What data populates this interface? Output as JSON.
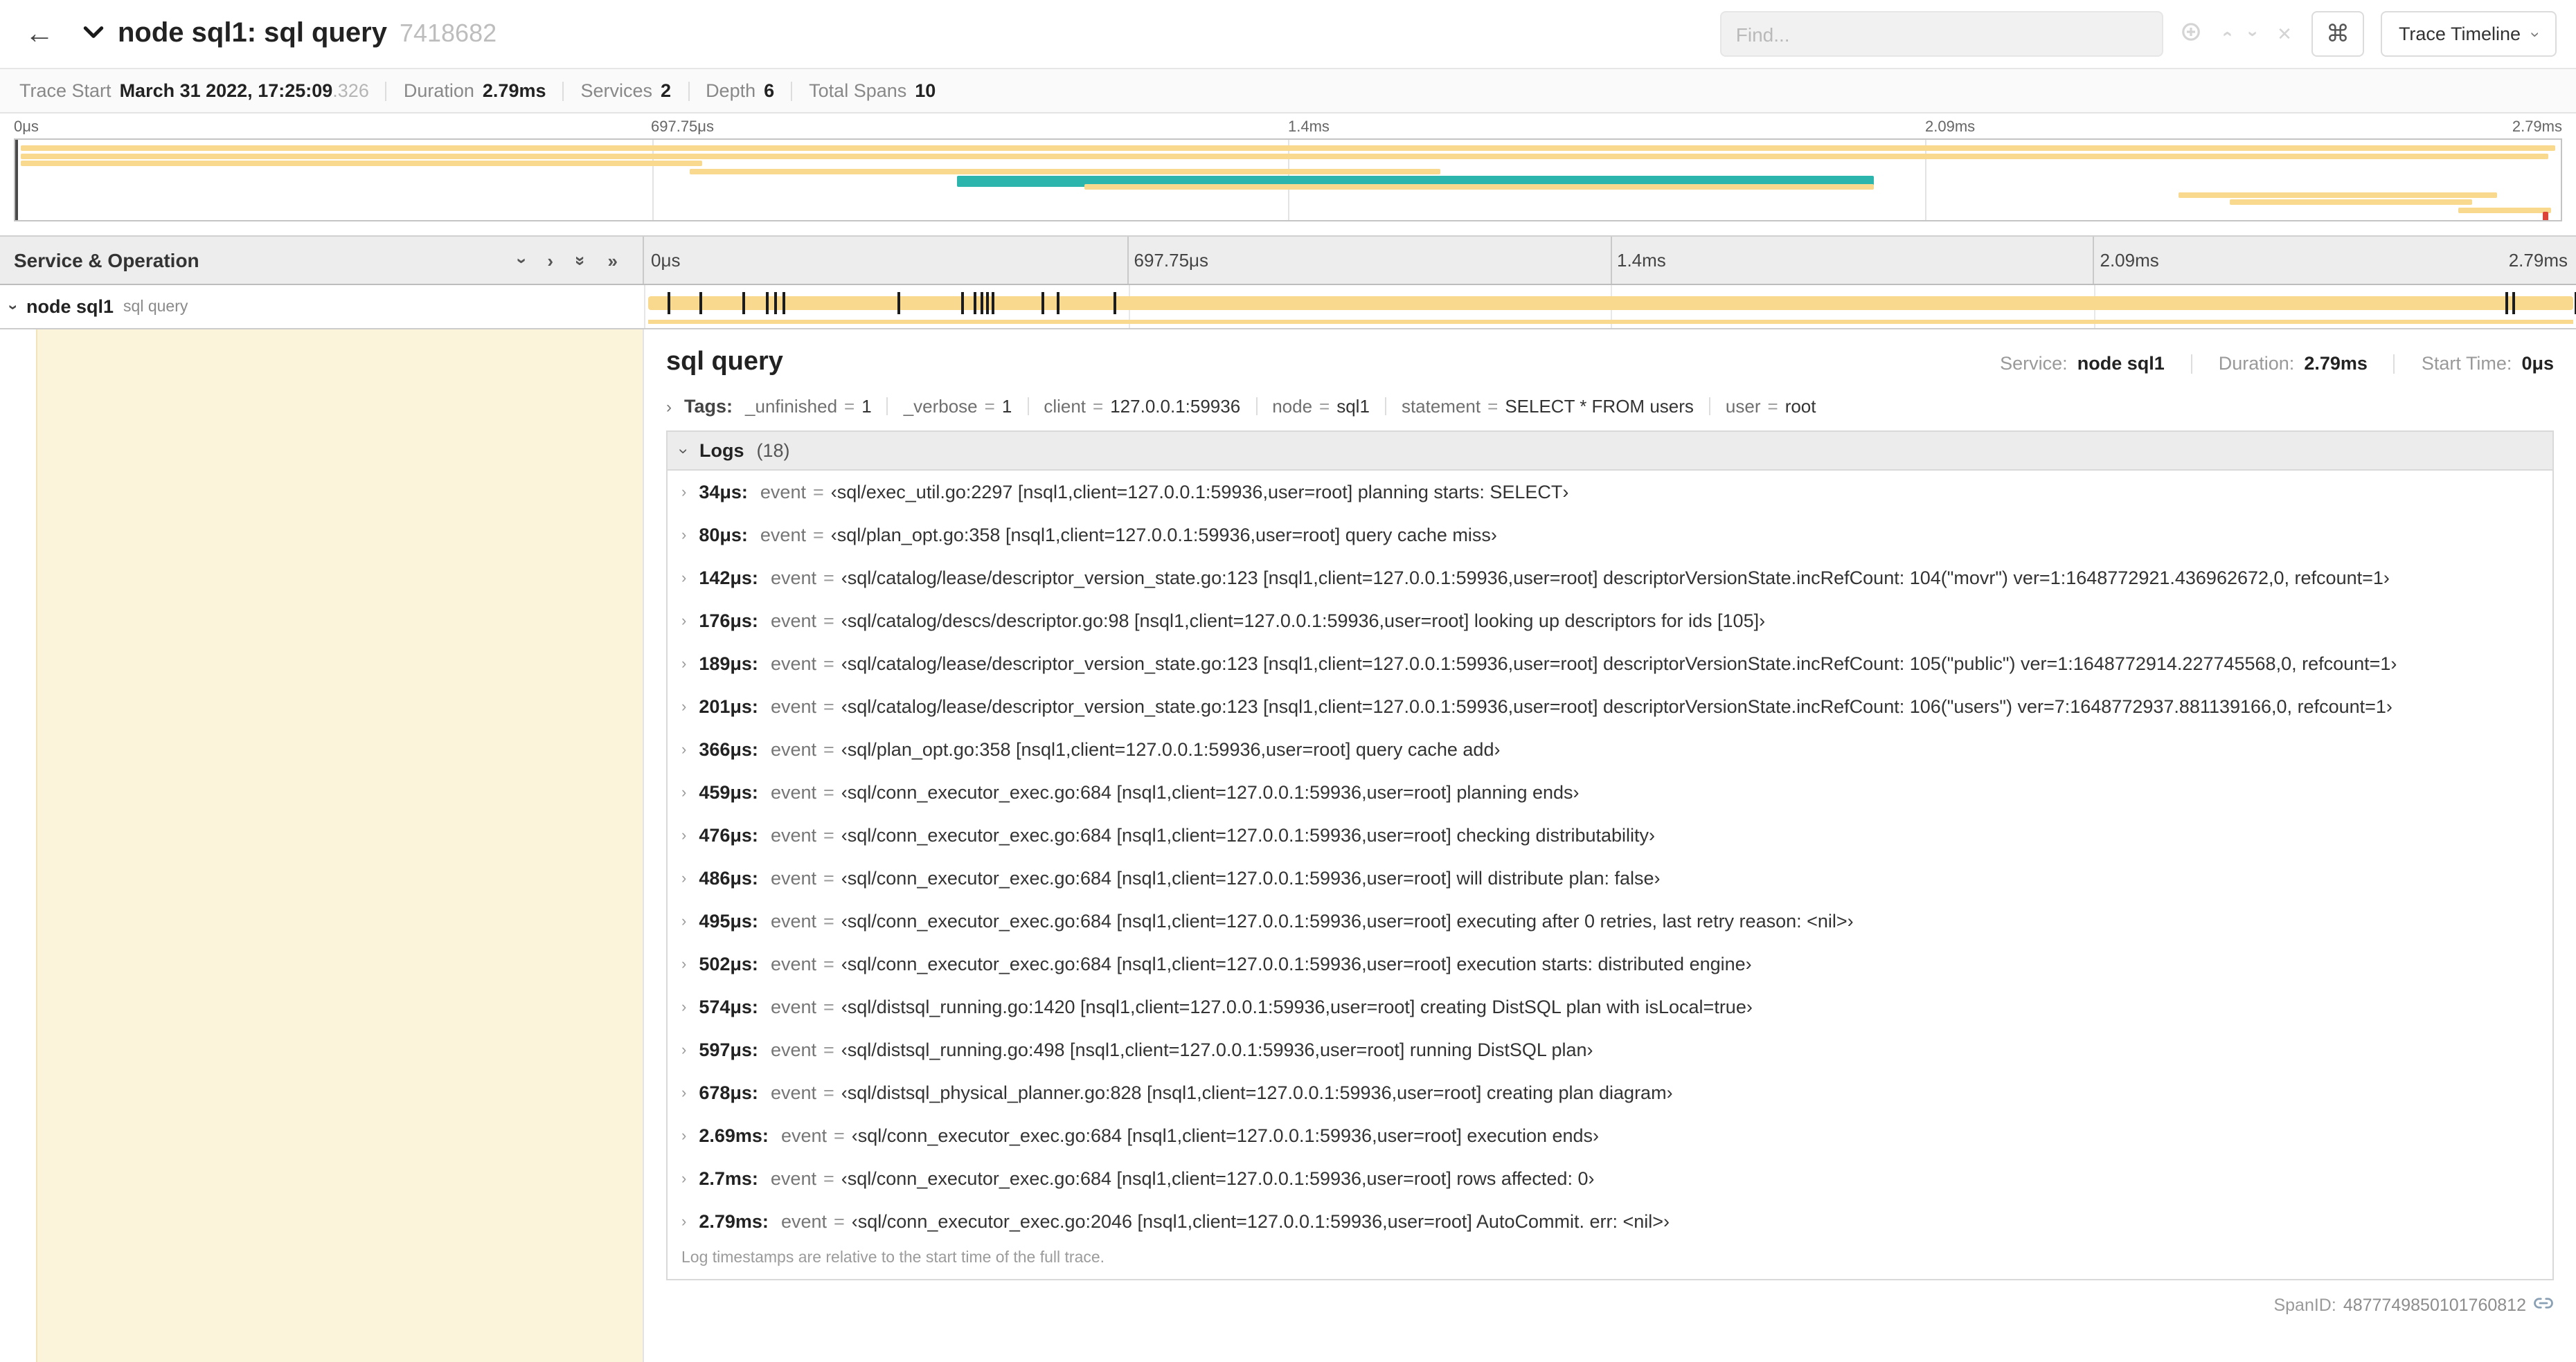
{
  "colors": {
    "tan": "#f8d98e",
    "teal": "#2bb5ad",
    "red": "#db4437",
    "cream": "#fcf4da"
  },
  "icons": {
    "chevron": "›",
    "double_chevron": "»",
    "close": "✕"
  },
  "trace": {
    "duration_us": 2790
  },
  "header": {
    "back_icon": "←",
    "title": "node sql1: sql query",
    "trace_id": "7418682",
    "find_placeholder": "Find...",
    "shortcut_icon": "⌘",
    "view_label": "Trace Timeline"
  },
  "summary": {
    "trace_start_label": "Trace Start",
    "trace_start_value": "March 31 2022, 17:25:09",
    "trace_start_frac": ".326",
    "duration_label": "Duration",
    "duration_value": "2.79ms",
    "services_label": "Services",
    "services_value": "2",
    "depth_label": "Depth",
    "depth_value": "6",
    "spans_label": "Total Spans",
    "spans_value": "10"
  },
  "timebar": {
    "ticks": [
      {
        "label": "0μs",
        "pct": 0
      },
      {
        "label": "697.75μs",
        "pct": 25
      },
      {
        "label": "1.4ms",
        "pct": 50
      },
      {
        "label": "2.09ms",
        "pct": 75
      },
      {
        "label": "2.79ms",
        "pct": 100
      }
    ]
  },
  "minimap": {
    "spans": [
      {
        "start_pct": 0.2,
        "end_pct": 99.8,
        "row": 0,
        "color": "tan"
      },
      {
        "start_pct": 0.2,
        "end_pct": 99.5,
        "row": 1,
        "color": "tan"
      },
      {
        "start_pct": 0.2,
        "end_pct": 27,
        "row": 2,
        "color": "tan"
      },
      {
        "start_pct": 26.5,
        "end_pct": 56,
        "row": 3,
        "color": "tan"
      },
      {
        "start_pct": 37,
        "end_pct": 73,
        "row": 4,
        "color": "teal"
      },
      {
        "start_pct": 42,
        "end_pct": 73,
        "row": 5,
        "color": "tan"
      },
      {
        "start_pct": 85,
        "end_pct": 97.5,
        "row": 6,
        "color": "tan"
      },
      {
        "start_pct": 87,
        "end_pct": 96.5,
        "row": 7,
        "color": "tan"
      },
      {
        "start_pct": 96,
        "end_pct": 99.6,
        "row": 8,
        "color": "tan"
      },
      {
        "start_pct": 99.3,
        "end_pct": 99.7,
        "row": 8.6,
        "color": "red"
      }
    ]
  },
  "timeline": {
    "left_header": "Service & Operation"
  },
  "row": {
    "service": "node sql1",
    "operation": "sql query",
    "log_marks_us": [
      34,
      80,
      142,
      176,
      189,
      201,
      366,
      459,
      476,
      486,
      495,
      502,
      574,
      597,
      678,
      2690,
      2700,
      2790
    ]
  },
  "detail": {
    "title": "sql query",
    "service_label": "Service:",
    "service_value": "node sql1",
    "duration_label": "Duration:",
    "duration_value": "2.79ms",
    "start_label": "Start Time:",
    "start_value": "0μs",
    "tags_label": "Tags:",
    "kv_eq": "=",
    "tags": [
      {
        "key": "_unfinished",
        "value": "1"
      },
      {
        "key": "_verbose",
        "value": "1"
      },
      {
        "key": "client",
        "value": "127.0.0.1:59936"
      },
      {
        "key": "node",
        "value": "sql1"
      },
      {
        "key": "statement",
        "value": "SELECT * FROM users"
      },
      {
        "key": "user",
        "value": "root"
      }
    ],
    "logs_label": "Logs",
    "logs_count": "(18)",
    "logs": [
      {
        "time": "34μs:",
        "key": "event",
        "value": "‹sql/exec_util.go:2297 [nsql1,client=127.0.0.1:59936,user=root] planning starts: SELECT›"
      },
      {
        "time": "80μs:",
        "key": "event",
        "value": "‹sql/plan_opt.go:358 [nsql1,client=127.0.0.1:59936,user=root] query cache miss›"
      },
      {
        "time": "142μs:",
        "key": "event",
        "value": "‹sql/catalog/lease/descriptor_version_state.go:123 [nsql1,client=127.0.0.1:59936,user=root] descriptorVersionState.incRefCount: 104(\"movr\") ver=1:1648772921.436962672,0, refcount=1›"
      },
      {
        "time": "176μs:",
        "key": "event",
        "value": "‹sql/catalog/descs/descriptor.go:98 [nsql1,client=127.0.0.1:59936,user=root] looking up descriptors for ids [105]›"
      },
      {
        "time": "189μs:",
        "key": "event",
        "value": "‹sql/catalog/lease/descriptor_version_state.go:123 [nsql1,client=127.0.0.1:59936,user=root] descriptorVersionState.incRefCount: 105(\"public\") ver=1:1648772914.227745568,0, refcount=1›"
      },
      {
        "time": "201μs:",
        "key": "event",
        "value": "‹sql/catalog/lease/descriptor_version_state.go:123 [nsql1,client=127.0.0.1:59936,user=root] descriptorVersionState.incRefCount: 106(\"users\") ver=7:1648772937.881139166,0, refcount=1›"
      },
      {
        "time": "366μs:",
        "key": "event",
        "value": "‹sql/plan_opt.go:358 [nsql1,client=127.0.0.1:59936,user=root] query cache add›"
      },
      {
        "time": "459μs:",
        "key": "event",
        "value": "‹sql/conn_executor_exec.go:684 [nsql1,client=127.0.0.1:59936,user=root] planning ends›"
      },
      {
        "time": "476μs:",
        "key": "event",
        "value": "‹sql/conn_executor_exec.go:684 [nsql1,client=127.0.0.1:59936,user=root] checking distributability›"
      },
      {
        "time": "486μs:",
        "key": "event",
        "value": "‹sql/conn_executor_exec.go:684 [nsql1,client=127.0.0.1:59936,user=root] will distribute plan: false›"
      },
      {
        "time": "495μs:",
        "key": "event",
        "value": "‹sql/conn_executor_exec.go:684 [nsql1,client=127.0.0.1:59936,user=root] executing after 0 retries, last retry reason: <nil>›"
      },
      {
        "time": "502μs:",
        "key": "event",
        "value": "‹sql/conn_executor_exec.go:684 [nsql1,client=127.0.0.1:59936,user=root] execution starts: distributed engine›"
      },
      {
        "time": "574μs:",
        "key": "event",
        "value": "‹sql/distsql_running.go:1420 [nsql1,client=127.0.0.1:59936,user=root] creating DistSQL plan with isLocal=true›"
      },
      {
        "time": "597μs:",
        "key": "event",
        "value": "‹sql/distsql_running.go:498 [nsql1,client=127.0.0.1:59936,user=root] running DistSQL plan›"
      },
      {
        "time": "678μs:",
        "key": "event",
        "value": "‹sql/distsql_physical_planner.go:828 [nsql1,client=127.0.0.1:59936,user=root] creating plan diagram›"
      },
      {
        "time": "2.69ms:",
        "key": "event",
        "value": "‹sql/conn_executor_exec.go:684 [nsql1,client=127.0.0.1:59936,user=root] execution ends›"
      },
      {
        "time": "2.7ms:",
        "key": "event",
        "value": "‹sql/conn_executor_exec.go:684 [nsql1,client=127.0.0.1:59936,user=root] rows affected: 0›"
      },
      {
        "time": "2.79ms:",
        "key": "event",
        "value": "‹sql/conn_executor_exec.go:2046 [nsql1,client=127.0.0.1:59936,user=root] AutoCommit. err: <nil>›"
      }
    ],
    "logs_footnote": "Log timestamps are relative to the start time of the full trace.",
    "span_id_label": "SpanID:",
    "span_id": "4877749850101760812"
  }
}
